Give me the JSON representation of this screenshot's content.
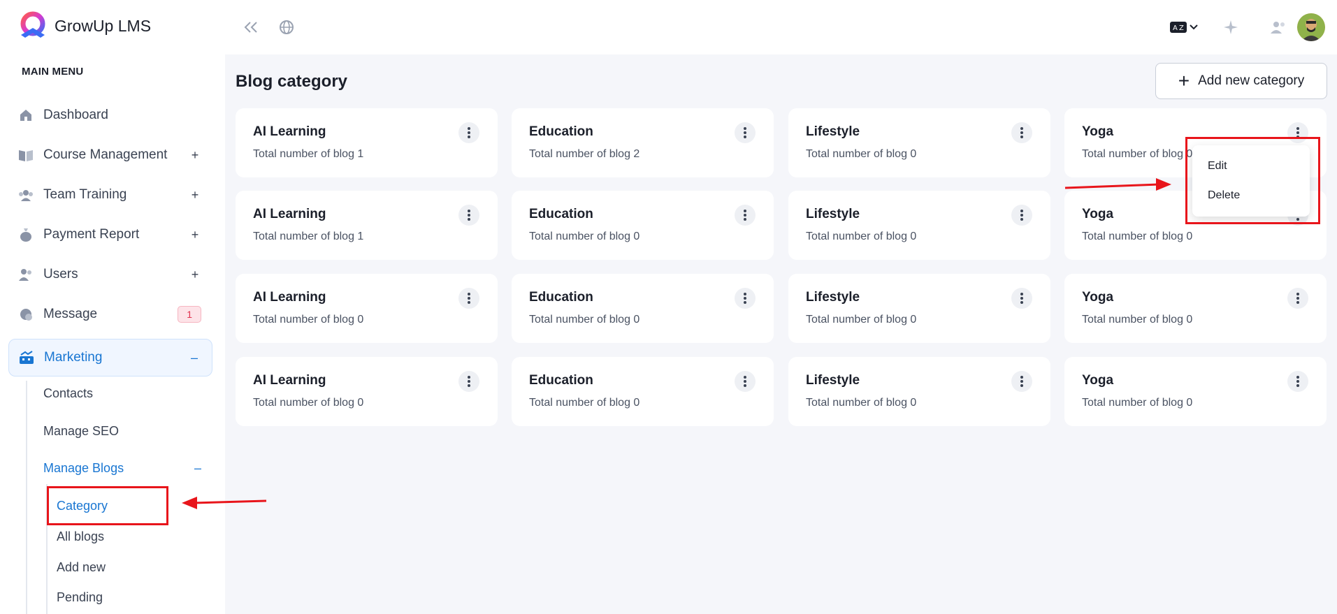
{
  "brand": {
    "name": "GrowUp LMS"
  },
  "sidebar": {
    "menu_title": "MAIN MENU",
    "items": [
      {
        "label": "Dashboard",
        "toggle": ""
      },
      {
        "label": "Course Management",
        "toggle": "+"
      },
      {
        "label": "Team Training",
        "toggle": "+"
      },
      {
        "label": "Payment Report",
        "toggle": "+"
      },
      {
        "label": "Users",
        "toggle": "+"
      },
      {
        "label": "Message",
        "badge": "1"
      },
      {
        "label": "Marketing",
        "toggle": "–"
      }
    ],
    "sub_items": [
      {
        "label": "Contacts"
      },
      {
        "label": "Manage SEO"
      },
      {
        "label": "Manage Blogs",
        "toggle": "–"
      }
    ],
    "blog_items": [
      {
        "label": "Category"
      },
      {
        "label": "All blogs"
      },
      {
        "label": "Add new"
      },
      {
        "label": "Pending"
      }
    ]
  },
  "header": {
    "language_icon": "language-az-icon",
    "colors": {
      "accent": "#1976d2",
      "annotation": "#e8151b"
    }
  },
  "main": {
    "title": "Blog category",
    "add_button": "Add new category",
    "cards": [
      [
        {
          "title": "AI Learning",
          "subtitle": "Total number of blog 1"
        },
        {
          "title": "Education",
          "subtitle": "Total number of blog 2"
        },
        {
          "title": "Lifestyle",
          "subtitle": "Total number of blog 0"
        },
        {
          "title": "Yoga",
          "subtitle": "Total number of blog 0"
        }
      ],
      [
        {
          "title": "AI Learning",
          "subtitle": "Total number of blog 1"
        },
        {
          "title": "Education",
          "subtitle": "Total number of blog 0"
        },
        {
          "title": "Lifestyle",
          "subtitle": "Total number of blog 0"
        },
        {
          "title": "Yoga",
          "subtitle": "Total number of blog 0"
        }
      ],
      [
        {
          "title": "AI Learning",
          "subtitle": "Total number of blog 0"
        },
        {
          "title": "Education",
          "subtitle": "Total number of blog 0"
        },
        {
          "title": "Lifestyle",
          "subtitle": "Total number of blog 0"
        },
        {
          "title": "Yoga",
          "subtitle": "Total number of blog 0"
        }
      ],
      [
        {
          "title": "AI Learning",
          "subtitle": "Total number of blog 0"
        },
        {
          "title": "Education",
          "subtitle": "Total number of blog 0"
        },
        {
          "title": "Lifestyle",
          "subtitle": "Total number of blog 0"
        },
        {
          "title": "Yoga",
          "subtitle": "Total number of blog 0"
        }
      ]
    ],
    "dropdown": {
      "edit": "Edit",
      "delete": "Delete"
    }
  }
}
